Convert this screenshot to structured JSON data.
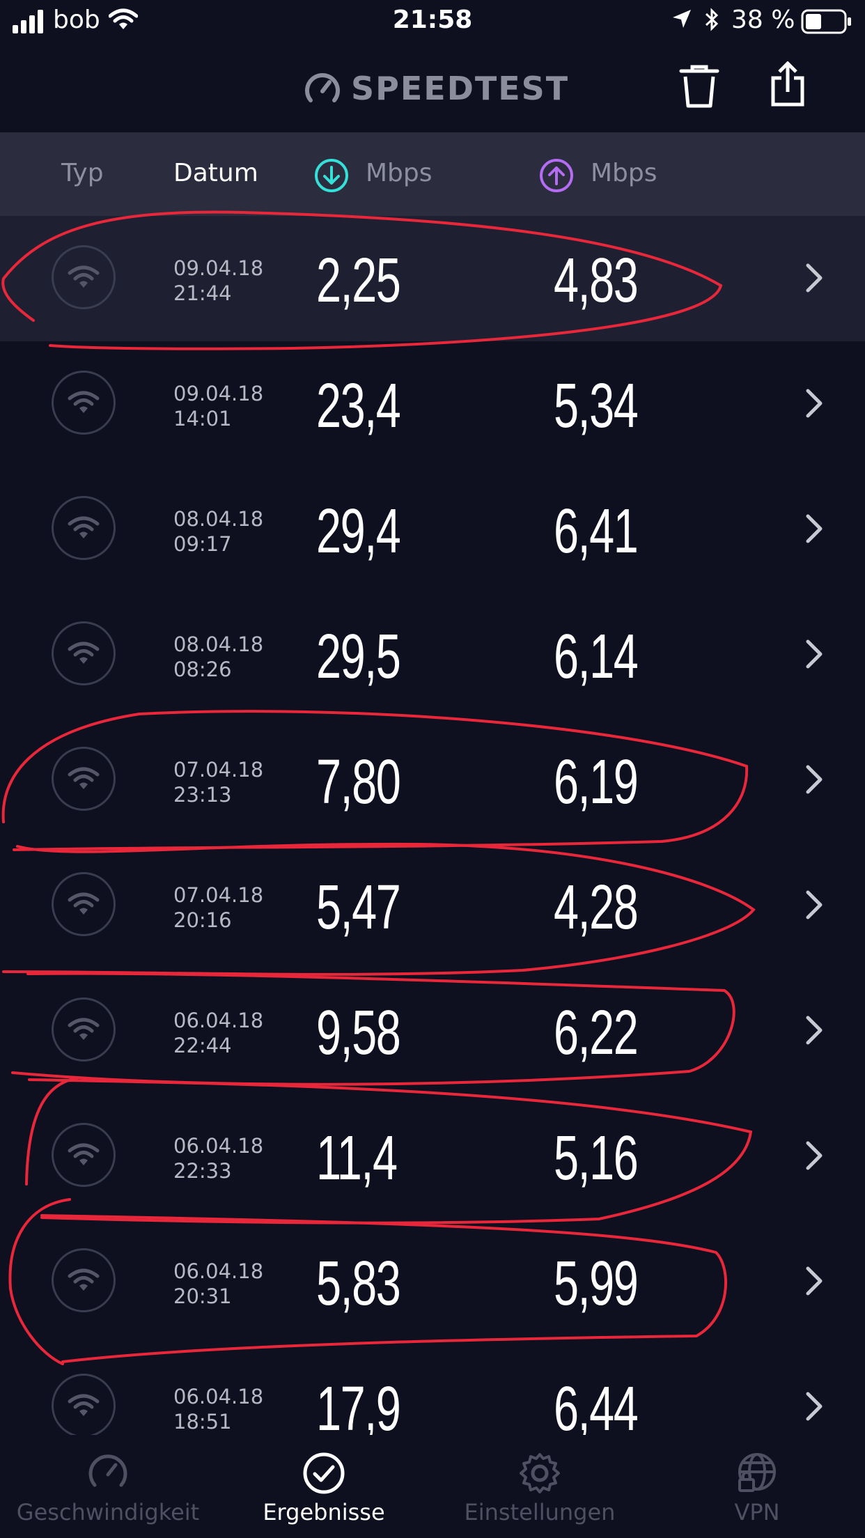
{
  "status_bar": {
    "carrier": "bob",
    "time": "21:58",
    "battery": "38 %"
  },
  "header": {
    "title": "SPEEDTEST",
    "trash_icon": "trash-icon",
    "share_icon": "share-icon"
  },
  "columns": {
    "type": "Typ",
    "date": "Datum",
    "download": "Mbps",
    "upload": "Mbps",
    "download_color": "#35e0d8",
    "upload_color": "#b46cf2"
  },
  "results": [
    {
      "date": "09.04.18",
      "time": "21:44",
      "download": "2,25",
      "upload": "4,83"
    },
    {
      "date": "09.04.18",
      "time": "14:01",
      "download": "23,4",
      "upload": "5,34"
    },
    {
      "date": "08.04.18",
      "time": "09:17",
      "download": "29,4",
      "upload": "6,41"
    },
    {
      "date": "08.04.18",
      "time": "08:26",
      "download": "29,5",
      "upload": "6,14"
    },
    {
      "date": "07.04.18",
      "time": "23:13",
      "download": "7,80",
      "upload": "6,19"
    },
    {
      "date": "07.04.18",
      "time": "20:16",
      "download": "5,47",
      "upload": "4,28"
    },
    {
      "date": "06.04.18",
      "time": "22:44",
      "download": "9,58",
      "upload": "6,22"
    },
    {
      "date": "06.04.18",
      "time": "22:33",
      "download": "11,4",
      "upload": "5,16"
    },
    {
      "date": "06.04.18",
      "time": "20:31",
      "download": "5,83",
      "upload": "5,99"
    },
    {
      "date": "06.04.18",
      "time": "18:51",
      "download": "17,9",
      "upload": "6,44"
    }
  ],
  "tabs": [
    {
      "label": "Geschwindigkeit",
      "icon": "speedometer-icon"
    },
    {
      "label": "Ergebnisse",
      "icon": "check-circle-icon"
    },
    {
      "label": "Einstellungen",
      "icon": "gear-icon"
    },
    {
      "label": "VPN",
      "icon": "globe-lock-icon"
    }
  ],
  "accent_annotation_color": "#e8283a"
}
